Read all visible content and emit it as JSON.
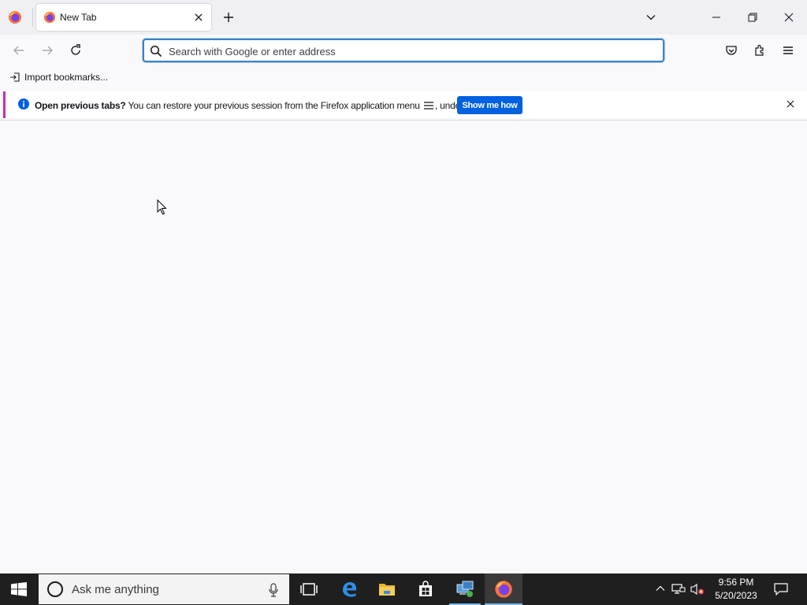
{
  "browser": {
    "tab": {
      "title": "New Tab"
    },
    "urlbar": {
      "placeholder": "Search with Google or enter address",
      "value": ""
    },
    "bookmarks": {
      "import_label": "Import bookmarks..."
    },
    "notification": {
      "title": "Open previous tabs?",
      "message_before": "You can restore your previous session from the Firefox application menu",
      "message_after": ", under History.",
      "button_label": "Show me how"
    }
  },
  "taskbar": {
    "search_placeholder": "Ask me anything",
    "clock_time": "9:56 PM",
    "clock_date": "5/20/2023"
  },
  "colors": {
    "accent": "#0061e0",
    "urlbar_focus": "#3b82c8",
    "notification_stripe": "#c030b0",
    "taskbar": "#1f1f1f"
  },
  "icons": {
    "tab": "firefox-icon",
    "nav": [
      "back-arrow-icon",
      "forward-arrow-icon",
      "reload-icon"
    ],
    "toolbar": [
      "pocket-icon",
      "extensions-icon",
      "hamburger-menu-icon"
    ],
    "taskbar": [
      "windows-start-icon",
      "cortana-icon",
      "microphone-icon",
      "task-view-icon",
      "edge-icon",
      "file-explorer-icon",
      "store-icon",
      "remote-desktop-icon",
      "firefox-icon"
    ],
    "tray": [
      "chevron-up-icon",
      "network-icon",
      "volume-muted-icon",
      "action-center-icon"
    ]
  }
}
